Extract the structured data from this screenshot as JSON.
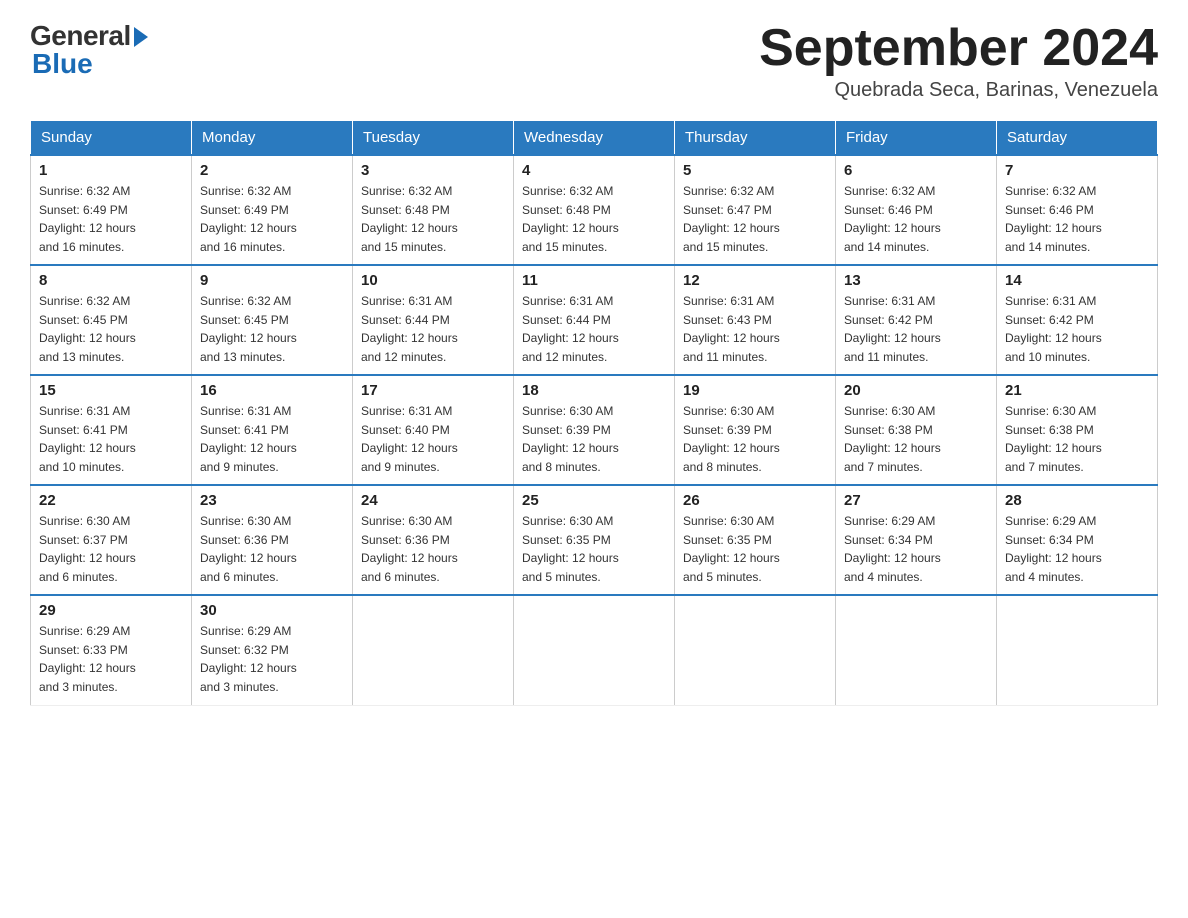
{
  "header": {
    "logo_general": "General",
    "logo_blue": "Blue",
    "title_month": "September 2024",
    "title_location": "Quebrada Seca, Barinas, Venezuela"
  },
  "calendar": {
    "days_of_week": [
      "Sunday",
      "Monday",
      "Tuesday",
      "Wednesday",
      "Thursday",
      "Friday",
      "Saturday"
    ],
    "weeks": [
      [
        {
          "day": "1",
          "sunrise": "6:32 AM",
          "sunset": "6:49 PM",
          "daylight": "12 hours and 16 minutes."
        },
        {
          "day": "2",
          "sunrise": "6:32 AM",
          "sunset": "6:49 PM",
          "daylight": "12 hours and 16 minutes."
        },
        {
          "day": "3",
          "sunrise": "6:32 AM",
          "sunset": "6:48 PM",
          "daylight": "12 hours and 15 minutes."
        },
        {
          "day": "4",
          "sunrise": "6:32 AM",
          "sunset": "6:48 PM",
          "daylight": "12 hours and 15 minutes."
        },
        {
          "day": "5",
          "sunrise": "6:32 AM",
          "sunset": "6:47 PM",
          "daylight": "12 hours and 15 minutes."
        },
        {
          "day": "6",
          "sunrise": "6:32 AM",
          "sunset": "6:46 PM",
          "daylight": "12 hours and 14 minutes."
        },
        {
          "day": "7",
          "sunrise": "6:32 AM",
          "sunset": "6:46 PM",
          "daylight": "12 hours and 14 minutes."
        }
      ],
      [
        {
          "day": "8",
          "sunrise": "6:32 AM",
          "sunset": "6:45 PM",
          "daylight": "12 hours and 13 minutes."
        },
        {
          "day": "9",
          "sunrise": "6:32 AM",
          "sunset": "6:45 PM",
          "daylight": "12 hours and 13 minutes."
        },
        {
          "day": "10",
          "sunrise": "6:31 AM",
          "sunset": "6:44 PM",
          "daylight": "12 hours and 12 minutes."
        },
        {
          "day": "11",
          "sunrise": "6:31 AM",
          "sunset": "6:44 PM",
          "daylight": "12 hours and 12 minutes."
        },
        {
          "day": "12",
          "sunrise": "6:31 AM",
          "sunset": "6:43 PM",
          "daylight": "12 hours and 11 minutes."
        },
        {
          "day": "13",
          "sunrise": "6:31 AM",
          "sunset": "6:42 PM",
          "daylight": "12 hours and 11 minutes."
        },
        {
          "day": "14",
          "sunrise": "6:31 AM",
          "sunset": "6:42 PM",
          "daylight": "12 hours and 10 minutes."
        }
      ],
      [
        {
          "day": "15",
          "sunrise": "6:31 AM",
          "sunset": "6:41 PM",
          "daylight": "12 hours and 10 minutes."
        },
        {
          "day": "16",
          "sunrise": "6:31 AM",
          "sunset": "6:41 PM",
          "daylight": "12 hours and 9 minutes."
        },
        {
          "day": "17",
          "sunrise": "6:31 AM",
          "sunset": "6:40 PM",
          "daylight": "12 hours and 9 minutes."
        },
        {
          "day": "18",
          "sunrise": "6:30 AM",
          "sunset": "6:39 PM",
          "daylight": "12 hours and 8 minutes."
        },
        {
          "day": "19",
          "sunrise": "6:30 AM",
          "sunset": "6:39 PM",
          "daylight": "12 hours and 8 minutes."
        },
        {
          "day": "20",
          "sunrise": "6:30 AM",
          "sunset": "6:38 PM",
          "daylight": "12 hours and 7 minutes."
        },
        {
          "day": "21",
          "sunrise": "6:30 AM",
          "sunset": "6:38 PM",
          "daylight": "12 hours and 7 minutes."
        }
      ],
      [
        {
          "day": "22",
          "sunrise": "6:30 AM",
          "sunset": "6:37 PM",
          "daylight": "12 hours and 6 minutes."
        },
        {
          "day": "23",
          "sunrise": "6:30 AM",
          "sunset": "6:36 PM",
          "daylight": "12 hours and 6 minutes."
        },
        {
          "day": "24",
          "sunrise": "6:30 AM",
          "sunset": "6:36 PM",
          "daylight": "12 hours and 6 minutes."
        },
        {
          "day": "25",
          "sunrise": "6:30 AM",
          "sunset": "6:35 PM",
          "daylight": "12 hours and 5 minutes."
        },
        {
          "day": "26",
          "sunrise": "6:30 AM",
          "sunset": "6:35 PM",
          "daylight": "12 hours and 5 minutes."
        },
        {
          "day": "27",
          "sunrise": "6:29 AM",
          "sunset": "6:34 PM",
          "daylight": "12 hours and 4 minutes."
        },
        {
          "day": "28",
          "sunrise": "6:29 AM",
          "sunset": "6:34 PM",
          "daylight": "12 hours and 4 minutes."
        }
      ],
      [
        {
          "day": "29",
          "sunrise": "6:29 AM",
          "sunset": "6:33 PM",
          "daylight": "12 hours and 3 minutes."
        },
        {
          "day": "30",
          "sunrise": "6:29 AM",
          "sunset": "6:32 PM",
          "daylight": "12 hours and 3 minutes."
        },
        null,
        null,
        null,
        null,
        null
      ]
    ]
  }
}
